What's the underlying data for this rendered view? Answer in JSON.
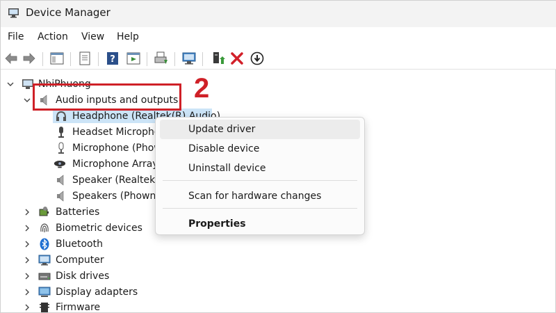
{
  "window": {
    "title": "Device Manager"
  },
  "menubar": {
    "file": "File",
    "action": "Action",
    "view": "View",
    "help": "Help"
  },
  "tree": {
    "computer_name": "NhiPhuong",
    "audio_category": "Audio inputs and outputs",
    "audio_devices": [
      "Headphone (Realtek(R) Audio)",
      "Headset Microphone (",
      "Microphone (Phow",
      "Microphone Array",
      "Speaker (Realtek(R",
      "Speakers (Phowng"
    ],
    "categories": [
      "Batteries",
      "Biometric devices",
      "Bluetooth",
      "Computer",
      "Disk drives",
      "Display adapters",
      "Firmware"
    ]
  },
  "annotation": {
    "step_number": "2"
  },
  "context_menu": {
    "update_driver": "Update driver",
    "disable_device": "Disable device",
    "uninstall_device": "Uninstall device",
    "scan_hardware": "Scan for hardware changes",
    "properties": "Properties"
  },
  "colors": {
    "annotation_red": "#cf2027",
    "selection_blue": "#cce4f7"
  }
}
